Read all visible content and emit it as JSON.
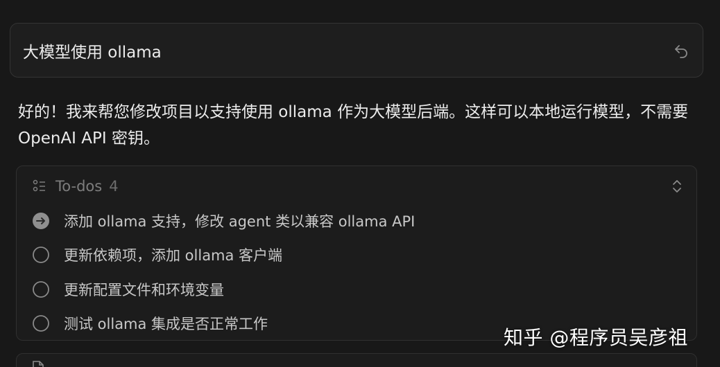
{
  "query": {
    "text": "大模型使用 ollama",
    "undo_icon": "undo-icon"
  },
  "response": {
    "text": "好的！我来帮您修改项目以支持使用 ollama 作为大模型后端。这样可以本地运行模型，不需要 OpenAI API 密钥。"
  },
  "todos": {
    "title": "To-dos",
    "count": "4",
    "items": [
      {
        "label": "添加 ollama 支持，修改 agent 类以兼容 ollama API",
        "status": "in-progress"
      },
      {
        "label": "更新依赖项，添加 ollama 客户端",
        "status": "pending"
      },
      {
        "label": "更新配置文件和环境变量",
        "status": "pending"
      },
      {
        "label": "测试 ollama 集成是否正常工作",
        "status": "pending"
      }
    ]
  },
  "watermark": {
    "text": "知乎 @程序员吴彦祖"
  },
  "colors": {
    "background": "#181818",
    "card": "#1c1c1c",
    "border": "#303030",
    "muted": "#7d7d7d"
  }
}
